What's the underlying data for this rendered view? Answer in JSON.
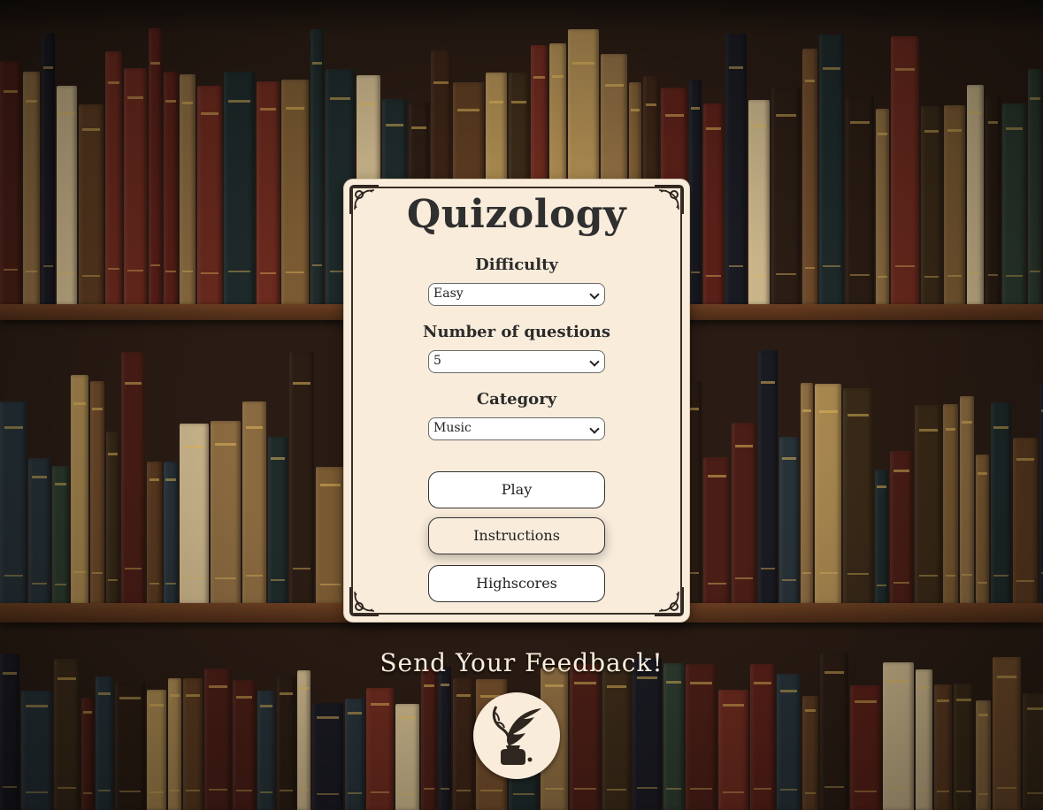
{
  "app": {
    "title": "Quizology"
  },
  "form": {
    "difficulty": {
      "label": "Difficulty",
      "value": "Easy"
    },
    "questions": {
      "label": "Number of questions",
      "value": "5"
    },
    "category": {
      "label": "Category",
      "value": "Music"
    }
  },
  "buttons": {
    "play": "Play",
    "instructions": "Instructions",
    "highscores": "Highscores"
  },
  "feedback": {
    "title": "Send Your Feedback!",
    "icon": "quill-inkwell-icon"
  },
  "colors": {
    "card_background": "#f9ecdb",
    "frame": "#3a2e26",
    "title_text": "#2f2f2f",
    "feedback_text": "#f9ecdb"
  }
}
